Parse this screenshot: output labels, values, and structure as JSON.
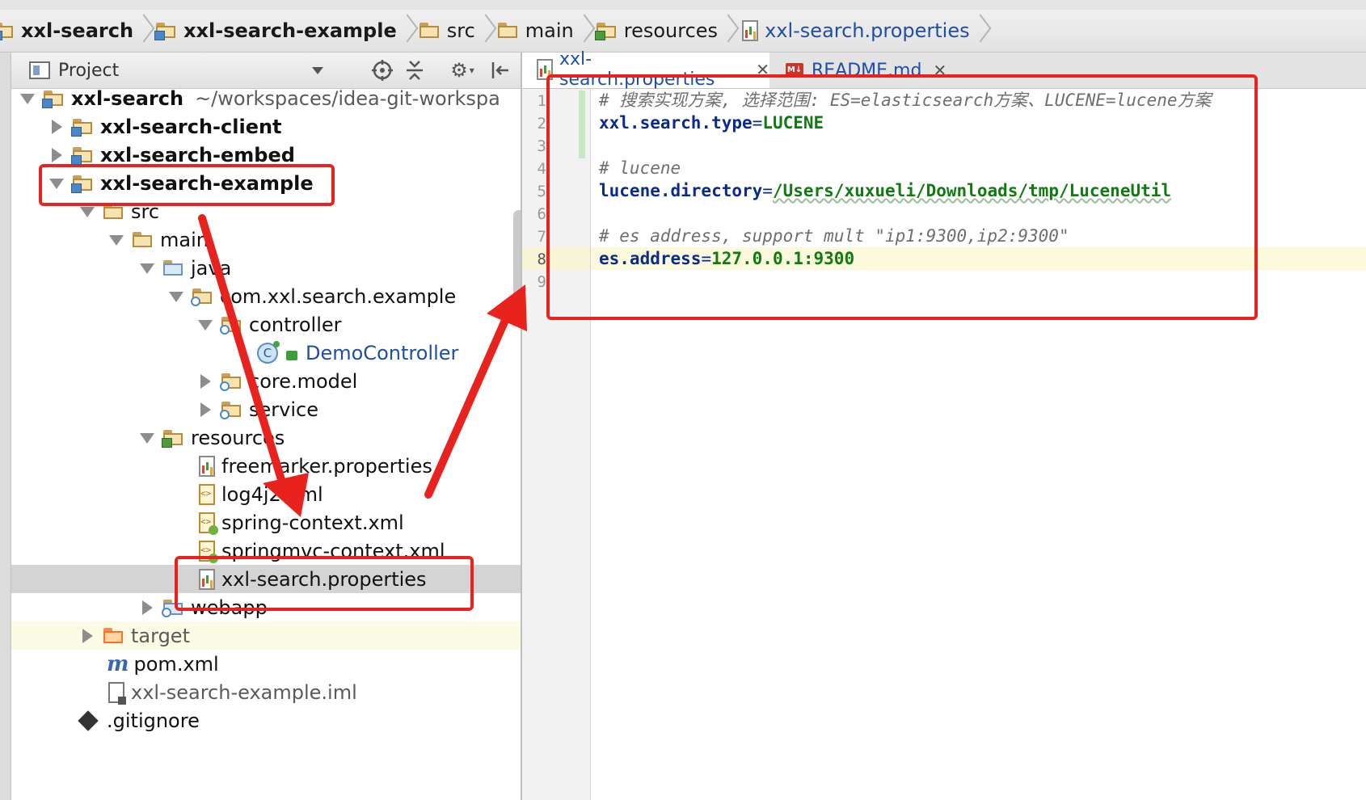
{
  "breadcrumb": [
    "xxl-search",
    "xxl-search-example",
    "src",
    "main",
    "resources",
    "xxl-search.properties"
  ],
  "project_panel": {
    "title": "Project",
    "tools": [
      "target-icon",
      "collapse-icon",
      "gear-icon",
      "hide-icon"
    ]
  },
  "tree": [
    {
      "label": "xxl-search",
      "extra": "~/workspaces/idea-git-workspa",
      "bold": true
    },
    {
      "label": "xxl-search-client",
      "bold": true
    },
    {
      "label": "xxl-search-embed",
      "bold": true
    },
    {
      "label": "xxl-search-example",
      "bold": true
    },
    {
      "label": "src"
    },
    {
      "label": "main"
    },
    {
      "label": "java"
    },
    {
      "label": "com.xxl.search.example"
    },
    {
      "label": "controller"
    },
    {
      "label": "DemoController"
    },
    {
      "label": "core.model"
    },
    {
      "label": "service"
    },
    {
      "label": "resources"
    },
    {
      "label": "freemarker.properties"
    },
    {
      "label": "log4j2.xml"
    },
    {
      "label": "spring-context.xml"
    },
    {
      "label": "springmvc-context.xml"
    },
    {
      "label": "xxl-search.properties"
    },
    {
      "label": "webapp"
    },
    {
      "label": "target"
    },
    {
      "label": "pom.xml"
    },
    {
      "label": "xxl-search-example.iml"
    },
    {
      "label": ".gitignore"
    }
  ],
  "tabs": [
    {
      "label": "xxl-search.properties",
      "active": true
    },
    {
      "label": "README.md",
      "active": false
    }
  ],
  "editor": {
    "line_numbers": [
      "1",
      "2",
      "3",
      "4",
      "5",
      "6",
      "7",
      "8",
      "9"
    ],
    "current_line": 8,
    "lines": [
      {
        "comment": "# 搜索实现方案, 选择范围: ES=elasticsearch方案、LUCENE=lucene方案"
      },
      {
        "key": "xxl.search.type",
        "value": "LUCENE"
      },
      {},
      {
        "comment": "# lucene"
      },
      {
        "key": "lucene.directory",
        "value": "/Users/xuxueli/Downloads/tmp/LuceneUtil"
      },
      {},
      {
        "comment": "# es address, support mult \"ip1:9300,ip2:9300\""
      },
      {
        "key": "es.address",
        "value": "127.0.0.1:9300"
      },
      {}
    ]
  },
  "colors": {
    "annotation_red": "#e8231e",
    "key_blue": "#0b2b8c",
    "value_green": "#127a12",
    "selection_gray": "#d4d4d4"
  }
}
